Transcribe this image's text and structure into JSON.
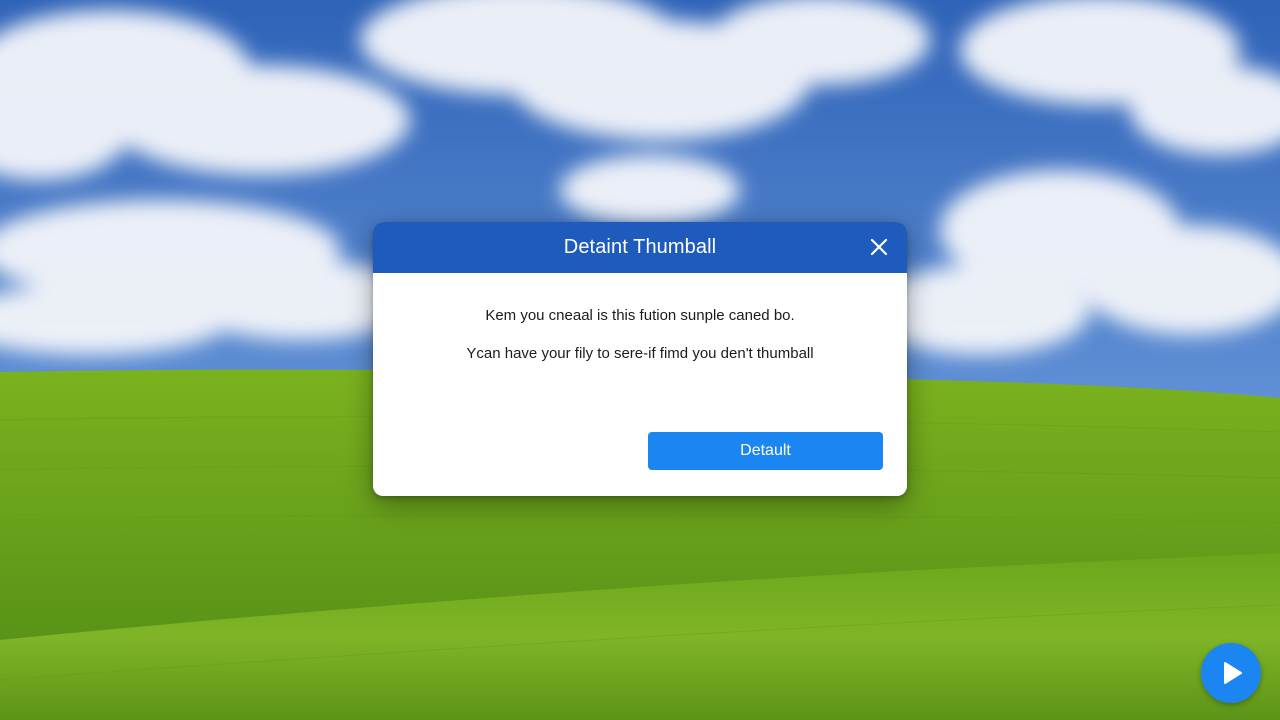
{
  "dialog": {
    "title": "Detaint Thumball",
    "message_line_1": "Kem you cneaal is this fution sunple caned bo.",
    "message_line_2": "Ycan have your fily to sere-if fimd you den't thumball",
    "primary_button_label": "Detault"
  },
  "icons": {
    "close": "close-icon",
    "play": "play-icon"
  },
  "colors": {
    "header": "#1f5bbd",
    "button": "#1b86f2",
    "fab": "#1b86f2",
    "sky": "#3a72c4",
    "grass": "#6a9a1c"
  }
}
